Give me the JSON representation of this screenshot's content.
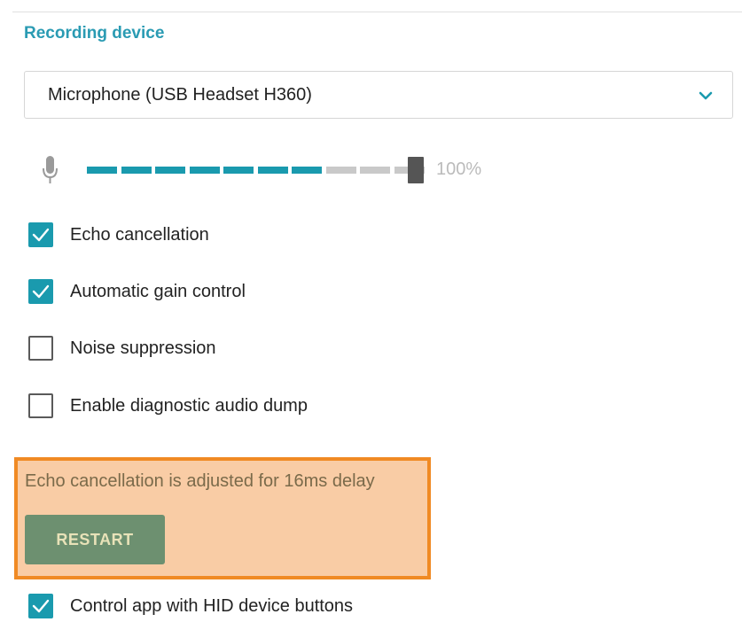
{
  "section": {
    "title": "Recording device"
  },
  "device_select": {
    "value": "Microphone (USB Headset H360)",
    "chevron_icon": "chevron-down-icon"
  },
  "level_meter": {
    "icon": "microphone-icon",
    "level_percent": 0.7,
    "volume_label": "100%",
    "volume_value": 1.0
  },
  "checkboxes": [
    {
      "label": "Echo cancellation",
      "checked": true
    },
    {
      "label": "Automatic gain control",
      "checked": true
    },
    {
      "label": "Noise suppression",
      "checked": false
    },
    {
      "label": "Enable diagnostic audio dump",
      "checked": false
    }
  ],
  "notice": {
    "message": "Echo cancellation is adjusted for 16ms delay",
    "button_label": "RESTART"
  },
  "hid_option": {
    "label": "Control app with HID device buttons",
    "checked": true
  },
  "colors": {
    "accent": "#1a9aae",
    "title": "#2a9bb3",
    "highlight_border": "#f08a24",
    "highlight_bg": "#f9cca5",
    "button_bg": "#6d9070"
  }
}
